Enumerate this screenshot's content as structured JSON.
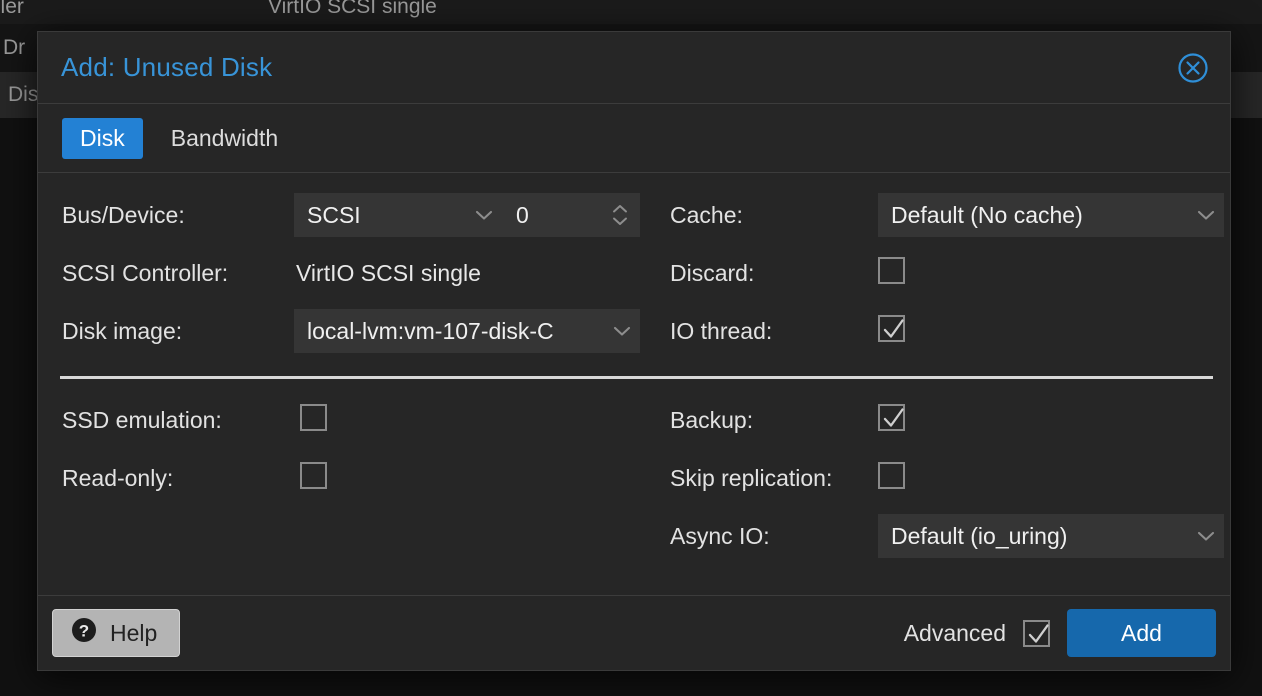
{
  "background": {
    "rows": [
      {
        "key": "ontroller",
        "value": "VirtIO SCSI single"
      },
      {
        "key": "D Dr",
        "value": ""
      },
      {
        "key": "Dis",
        "value": ""
      }
    ]
  },
  "dialog": {
    "title": "Add: Unused Disk",
    "close_icon": "close-circle-icon",
    "tabs": [
      {
        "label": "Disk",
        "active": true
      },
      {
        "label": "Bandwidth",
        "active": false
      }
    ],
    "form": {
      "left": [
        {
          "label": "Bus/Device:",
          "type": "combo-spinner",
          "select_value": "SCSI",
          "spin_value": "0"
        },
        {
          "label": "SCSI Controller:",
          "type": "static",
          "value": "VirtIO SCSI single"
        },
        {
          "label": "Disk image:",
          "type": "select",
          "value": "local-lvm:vm-107-disk-C"
        },
        {
          "label": "SSD emulation:",
          "type": "checkbox",
          "checked": false
        },
        {
          "label": "Read-only:",
          "type": "checkbox",
          "checked": false
        }
      ],
      "right": [
        {
          "label": "Cache:",
          "type": "select",
          "value": "Default (No cache)"
        },
        {
          "label": "Discard:",
          "type": "checkbox",
          "checked": false
        },
        {
          "label": "IO thread:",
          "type": "checkbox",
          "checked": true
        },
        {
          "label": "Backup:",
          "type": "checkbox",
          "checked": true
        },
        {
          "label": "Skip replication:",
          "type": "checkbox",
          "checked": false
        },
        {
          "label": "Async IO:",
          "type": "select",
          "value": "Default (io_uring)"
        }
      ]
    },
    "footer": {
      "help_label": "Help",
      "help_icon": "question-circle-icon",
      "advanced_label": "Advanced",
      "advanced_checked": true,
      "add_label": "Add"
    }
  },
  "colors": {
    "accent_blue": "#2381d4",
    "title_blue": "#3894d8",
    "add_button_blue": "#1668ac",
    "dialog_bg": "#262626",
    "field_bg": "#353535"
  }
}
